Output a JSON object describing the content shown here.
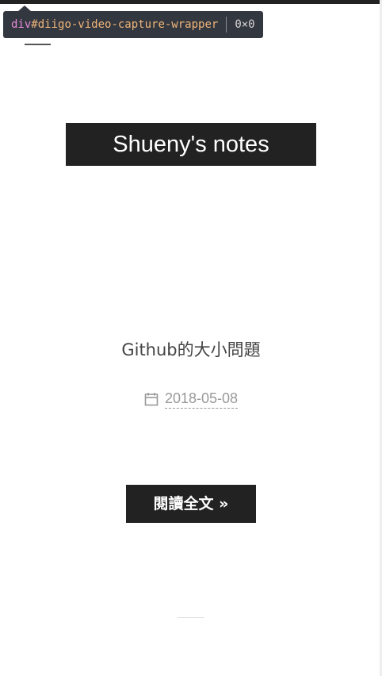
{
  "inspector_tooltip": {
    "tag": "div",
    "id_selector": "#diigo-video-capture-wrapper",
    "dimensions": "0×0"
  },
  "site": {
    "title": "Shueny's notes"
  },
  "post": {
    "title": "Github的大小問題",
    "date": "2018-05-08",
    "date_icon": "calendar-icon",
    "read_more_label": "閱讀全文 »"
  },
  "colors": {
    "dark_block": "#222222",
    "tooltip_bg": "#333740",
    "meta_text": "#999999"
  }
}
